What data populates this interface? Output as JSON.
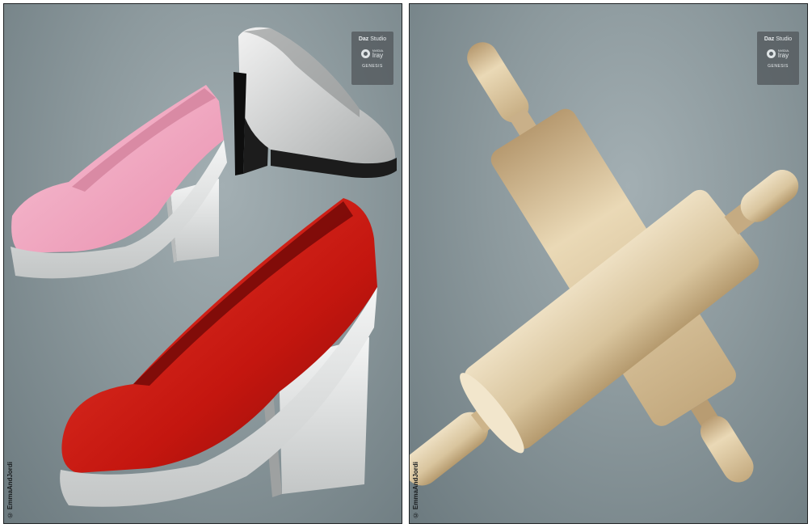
{
  "panels": {
    "left": {
      "badge": {
        "brand": "Daz",
        "product": "Studio",
        "nvidia": "NVIDIA.",
        "renderer": "Iray",
        "genesis": "GENESIS"
      },
      "copyright": "© EmmaAndJordi"
    },
    "right": {
      "badge": {
        "brand": "Daz",
        "product": "Studio",
        "nvidia": "NVIDIA.",
        "renderer": "Iray",
        "genesis": "GENESIS"
      },
      "copyright": "© EmmaAndJordi"
    }
  },
  "colors": {
    "background": "#8c999d",
    "pink_shoe": "#f2a9c2",
    "white_shoe": "#e6e7e6",
    "red_shoe": "#d8211b",
    "sole": "#dfe1e1",
    "black_heel": "#1c1c1c",
    "wood": "#dcc9a4"
  },
  "icons": [
    "nvidia-icon",
    "genesis-icon"
  ]
}
